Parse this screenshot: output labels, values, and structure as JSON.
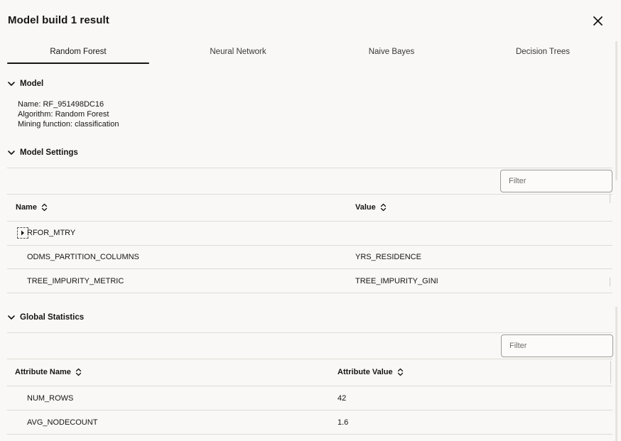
{
  "dialog": {
    "title": "Model build 1 result"
  },
  "tabs": [
    {
      "label": "Random Forest",
      "active": true
    },
    {
      "label": "Neural Network",
      "active": false
    },
    {
      "label": "Naive Bayes",
      "active": false
    },
    {
      "label": "Decision Trees",
      "active": false
    }
  ],
  "model_section": {
    "title": "Model",
    "name_line": "Name: RF_951498DC16",
    "algorithm_line": "Algorithm: Random Forest",
    "function_line": "Mining function: classification"
  },
  "settings_section": {
    "title": "Model Settings",
    "filter_placeholder": "Filter",
    "columns": [
      "Name",
      "Value"
    ],
    "rows": [
      {
        "name": "RFOR_MTRY",
        "value": "",
        "expandable": true
      },
      {
        "name": "ODMS_PARTITION_COLUMNS",
        "value": "YRS_RESIDENCE",
        "expandable": false
      },
      {
        "name": "TREE_IMPURITY_METRIC",
        "value": "TREE_IMPURITY_GINI",
        "expandable": false
      }
    ]
  },
  "stats_section": {
    "title": "Global Statistics",
    "filter_placeholder": "Filter",
    "columns": [
      "Attribute Name",
      "Attribute Value"
    ],
    "rows": [
      {
        "name": "NUM_ROWS",
        "value": "42"
      },
      {
        "name": "AVG_NODECOUNT",
        "value": "1.6"
      }
    ]
  },
  "icons": {
    "close": "close-icon",
    "section_toggle": "chevron-down-icon",
    "sort": "sort-icon",
    "row_expand": "caret-right-icon"
  }
}
